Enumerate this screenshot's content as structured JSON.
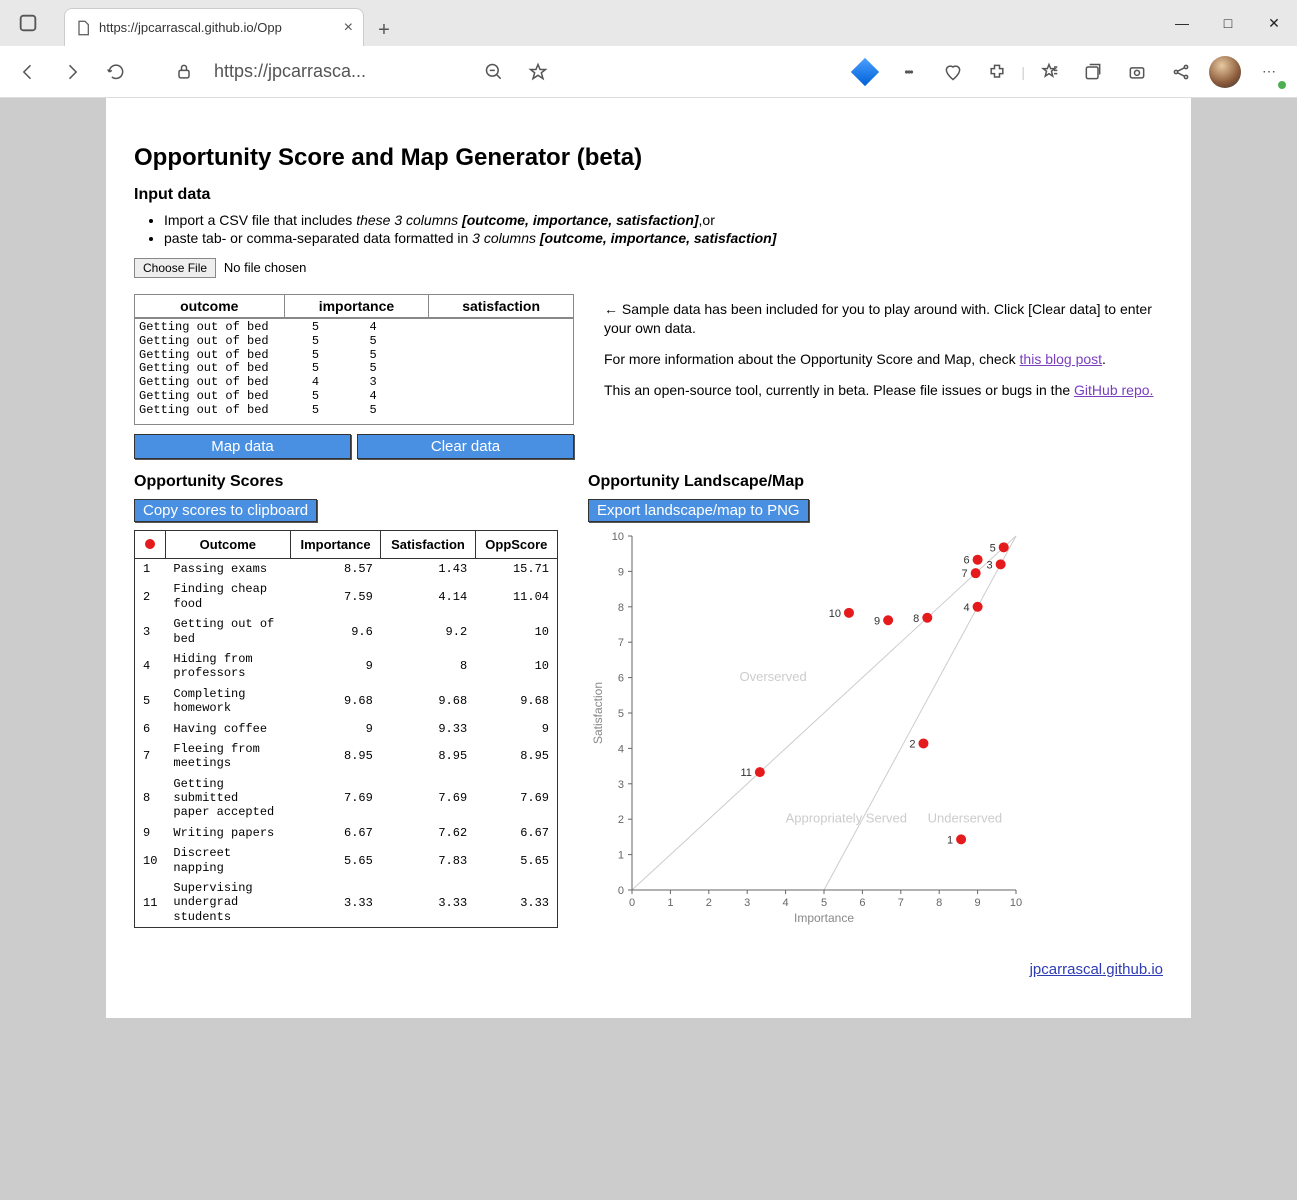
{
  "browser": {
    "tab_title": "https://jpcarrascal.github.io/Opp",
    "url_display": "https://jpcarrasca...",
    "file_chosen": "No file chosen",
    "choose_file": "Choose File"
  },
  "page": {
    "title": "Opportunity Score and Map Generator (beta)",
    "input_heading": "Input data",
    "import_li1_pre": "Import a CSV file that includes ",
    "import_li1_em": "these 3 columns ",
    "import_li1_b": "[outcome, importance, satisfaction]",
    "import_li1_post": ",or",
    "import_li2_pre": "paste tab- or comma-separated data formatted in ",
    "import_li2_em": "3 columns ",
    "import_li2_b": "[outcome, importance, satisfaction]",
    "headers": {
      "outcome": "outcome",
      "importance": "importance",
      "satisfaction": "satisfaction"
    },
    "textarea_value": "Getting out of bed\t5\t4\nGetting out of bed\t5\t5\nGetting out of bed\t5\t5\nGetting out of bed\t5\t5\nGetting out of bed\t4\t3\nGetting out of bed\t5\t4\nGetting out of bed\t5\t5\n",
    "map_btn": "Map data",
    "clear_btn": "Clear data",
    "hint1": "← Sample data has been included for you to play around with. Click [Clear data] to enter your own data.",
    "hint2_pre": "For more information about the Opportunity Score and Map, check ",
    "hint2_link": "this blog post",
    "hint3_pre": "This an open-source tool, currently in beta. Please file issues or bugs in the ",
    "hint3_link": "GitHub repo.",
    "scores_heading": "Opportunity Scores",
    "map_heading": "Opportunity Landscape/Map",
    "copy_btn": "Copy scores to clipboard",
    "export_btn": "Export landscape/map to PNG",
    "th": {
      "outcome": "Outcome",
      "importance": "Importance",
      "satisfaction": "Satisfaction",
      "oppscore": "OppScore"
    },
    "footer_link": "jpcarrascal.github.io"
  },
  "scores": [
    {
      "idx": "1",
      "outcome": "Passing exams",
      "imp": "8.57",
      "sat": "1.43",
      "opp": "15.71"
    },
    {
      "idx": "2",
      "outcome": "Finding cheap food",
      "imp": "7.59",
      "sat": "4.14",
      "opp": "11.04"
    },
    {
      "idx": "3",
      "outcome": "Getting out of bed",
      "imp": "9.6",
      "sat": "9.2",
      "opp": "10"
    },
    {
      "idx": "4",
      "outcome": "Hiding from professors",
      "imp": "9",
      "sat": "8",
      "opp": "10"
    },
    {
      "idx": "5",
      "outcome": "Completing homework",
      "imp": "9.68",
      "sat": "9.68",
      "opp": "9.68"
    },
    {
      "idx": "6",
      "outcome": "Having coffee",
      "imp": "9",
      "sat": "9.33",
      "opp": "9"
    },
    {
      "idx": "7",
      "outcome": "Fleeing from meetings",
      "imp": "8.95",
      "sat": "8.95",
      "opp": "8.95"
    },
    {
      "idx": "8",
      "outcome": "Getting submitted paper accepted",
      "imp": "7.69",
      "sat": "7.69",
      "opp": "7.69"
    },
    {
      "idx": "9",
      "outcome": "Writing papers",
      "imp": "6.67",
      "sat": "7.62",
      "opp": "6.67"
    },
    {
      "idx": "10",
      "outcome": "Discreet napping",
      "imp": "5.65",
      "sat": "7.83",
      "opp": "5.65"
    },
    {
      "idx": "11",
      "outcome": "Supervising undergrad students",
      "imp": "3.33",
      "sat": "3.33",
      "opp": "3.33"
    }
  ],
  "chart_data": {
    "type": "scatter",
    "title": "",
    "xlabel": "Importance",
    "ylabel": "Satisfaction",
    "xlim": [
      0,
      10
    ],
    "ylim": [
      0,
      10
    ],
    "regions": [
      "Overserved",
      "Appropriately Served",
      "Underserved"
    ],
    "series": [
      {
        "name": "outcomes",
        "points": [
          {
            "label": "1",
            "x": 8.57,
            "y": 1.43
          },
          {
            "label": "2",
            "x": 7.59,
            "y": 4.14
          },
          {
            "label": "3",
            "x": 9.6,
            "y": 9.2
          },
          {
            "label": "4",
            "x": 9.0,
            "y": 8.0
          },
          {
            "label": "5",
            "x": 9.68,
            "y": 9.68
          },
          {
            "label": "6",
            "x": 9.0,
            "y": 9.33
          },
          {
            "label": "7",
            "x": 8.95,
            "y": 8.95
          },
          {
            "label": "8",
            "x": 7.69,
            "y": 7.69
          },
          {
            "label": "9",
            "x": 6.67,
            "y": 7.62
          },
          {
            "label": "10",
            "x": 5.65,
            "y": 7.83
          },
          {
            "label": "11",
            "x": 3.33,
            "y": 3.33
          }
        ]
      }
    ]
  }
}
